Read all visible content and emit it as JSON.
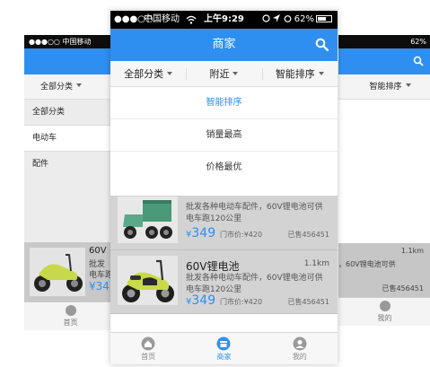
{
  "left_phone": {
    "status": {
      "signal": "●●●○○",
      "carrier": "中国移动"
    },
    "filter_label": "全部分类",
    "menu_items": [
      "全部分类",
      "电动车",
      "配件"
    ],
    "card": {
      "name_partial": "60V",
      "desc_partial_1": "批发",
      "desc_partial_2": "电车跑",
      "price_partial": "¥34"
    },
    "tab_label": "首页"
  },
  "right_phone": {
    "status": {
      "battery": "62%"
    },
    "filter_label": "智能排序",
    "card": {
      "dist": "1.1km",
      "desc_partial_1": "，60V锂电池可供",
      "sold": "已售456451"
    },
    "tab_label": "我的"
  },
  "status_bar": {
    "signal": "●●●○○",
    "carrier": "中国移动",
    "time": "上午9:29",
    "battery": "62%"
  },
  "header": {
    "title": "商家",
    "search_icon": "search-icon"
  },
  "filters": [
    {
      "label": "全部分类"
    },
    {
      "label": "附近"
    },
    {
      "label": "智能排序"
    }
  ],
  "dropdown": {
    "options": [
      "智能排序",
      "销量最高",
      "价格最优"
    ],
    "selected": "智能排序"
  },
  "colors": {
    "accent": "#2f8ff0",
    "status_bar": "#000000"
  },
  "listings": [
    {
      "name": "",
      "description": "批发各种电动车配件，60V锂电池可供电车跑120公里",
      "price_currency": "¥",
      "price": "349",
      "market_price": "门市价:¥420",
      "sold": "已售456451",
      "distance": ""
    },
    {
      "name": "60V锂电池",
      "description": "批发各种电动车配件，60V锂电池可供电车跑120公里",
      "price_currency": "¥",
      "price": "349",
      "market_price": "门市价:¥420",
      "sold": "已售456451",
      "distance": "1.1km"
    }
  ],
  "tabs": [
    {
      "label": "首页",
      "icon": "home-icon"
    },
    {
      "label": "商家",
      "icon": "shop-icon",
      "active": true
    },
    {
      "label": "我的",
      "icon": "profile-icon"
    }
  ]
}
